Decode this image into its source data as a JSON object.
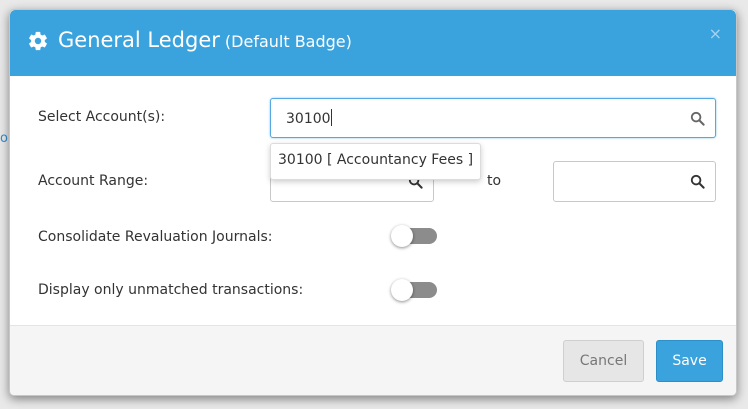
{
  "modal": {
    "title": "General Ledger",
    "subtitle": "(Default Badge)",
    "close_symbol": "×"
  },
  "form": {
    "select_accounts_label": "Select Account(s):",
    "select_accounts_value": "30100",
    "autocomplete_option": "30100 [ Accountancy Fees ]",
    "account_range_label": "Account Range:",
    "range_to_label": "to",
    "range_from_value": "",
    "range_to_value": "",
    "consolidate_label": "Consolidate Revaluation Journals:",
    "consolidate_enabled": false,
    "unmatched_label": "Display only unmatched transactions:",
    "unmatched_enabled": false
  },
  "footer": {
    "cancel_label": "Cancel",
    "save_label": "Save"
  },
  "icons": {
    "header": "gear-icon",
    "search": "search-icon",
    "close": "close-icon"
  },
  "colors": {
    "accent": "#3aa3dd",
    "toggle_off": "#8c8c8c",
    "cancel_bg": "#e6e6e6"
  }
}
